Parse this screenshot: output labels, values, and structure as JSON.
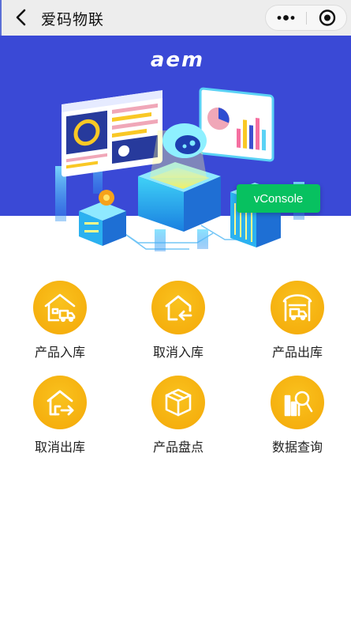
{
  "navbar": {
    "title": "爱码物联",
    "back_icon": "chevron-left-icon",
    "more_icon": "more-dots-icon",
    "close_icon": "target-close-icon"
  },
  "banner": {
    "logo_text": "aem",
    "background_color": "#3a49d6"
  },
  "vconsole": {
    "label": "vConsole",
    "color": "#07c160"
  },
  "menu": {
    "accent_color": "#f6b210",
    "items": [
      {
        "label": "产品入库",
        "icon": "warehouse-in-icon"
      },
      {
        "label": "取消入库",
        "icon": "cancel-in-icon"
      },
      {
        "label": "产品出库",
        "icon": "warehouse-out-icon"
      },
      {
        "label": "取消出库",
        "icon": "cancel-out-icon"
      },
      {
        "label": "产品盘点",
        "icon": "inventory-box-icon"
      },
      {
        "label": "数据查询",
        "icon": "data-search-icon"
      }
    ]
  }
}
